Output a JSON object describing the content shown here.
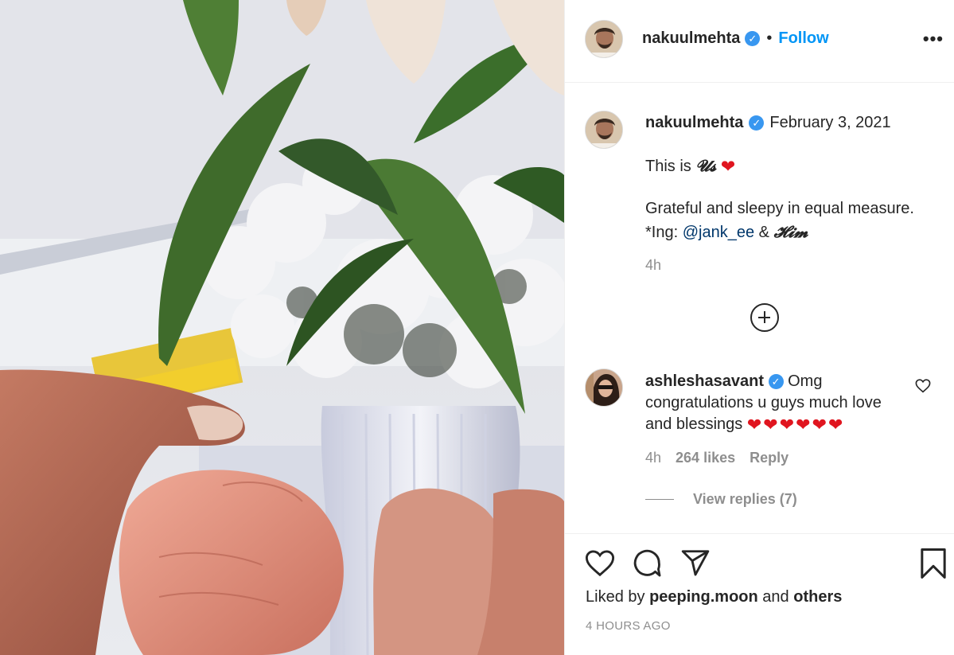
{
  "post": {
    "author": "nakuulmehta",
    "follow_label": "Follow",
    "separator": "•",
    "more_label": "•••",
    "verified_mark": "✓"
  },
  "caption": {
    "author": "nakuulmehta",
    "date": "February 3, 2021",
    "line1_prefix": "This is",
    "line1_script": "𝓤𝓼",
    "line1_heart": "❤",
    "line2": "Grateful and sleepy in equal measure.",
    "line3_prefix": "*Ing:",
    "line3_mention": "@jank_ee",
    "line3_amp": "&",
    "line3_script": "𝓗𝓲𝓶",
    "time": "4h"
  },
  "comment": {
    "author": "ashleshasavant",
    "text": "Omg congratulations u guys much love and blessings",
    "hearts": "❤❤❤❤❤❤",
    "time": "4h",
    "likes": "264 likes",
    "reply_label": "Reply",
    "view_replies": "View replies (7)"
  },
  "footer": {
    "liked_prefix": "Liked by",
    "liked_user": "peeping.moon",
    "liked_and": "and",
    "liked_others": "others",
    "time_ago": "4 HOURS AGO"
  },
  "icons": {
    "like": "heart-outline-icon",
    "comment": "comment-bubble-icon",
    "share": "paper-plane-icon",
    "save": "bookmark-icon",
    "add": "plus-circle-icon"
  },
  "colors": {
    "link_blue": "#0095f6",
    "mention_blue": "#00376b",
    "verified_blue": "#3897f0",
    "heart_red": "#e0151f",
    "muted_gray": "#8e8e8e"
  }
}
